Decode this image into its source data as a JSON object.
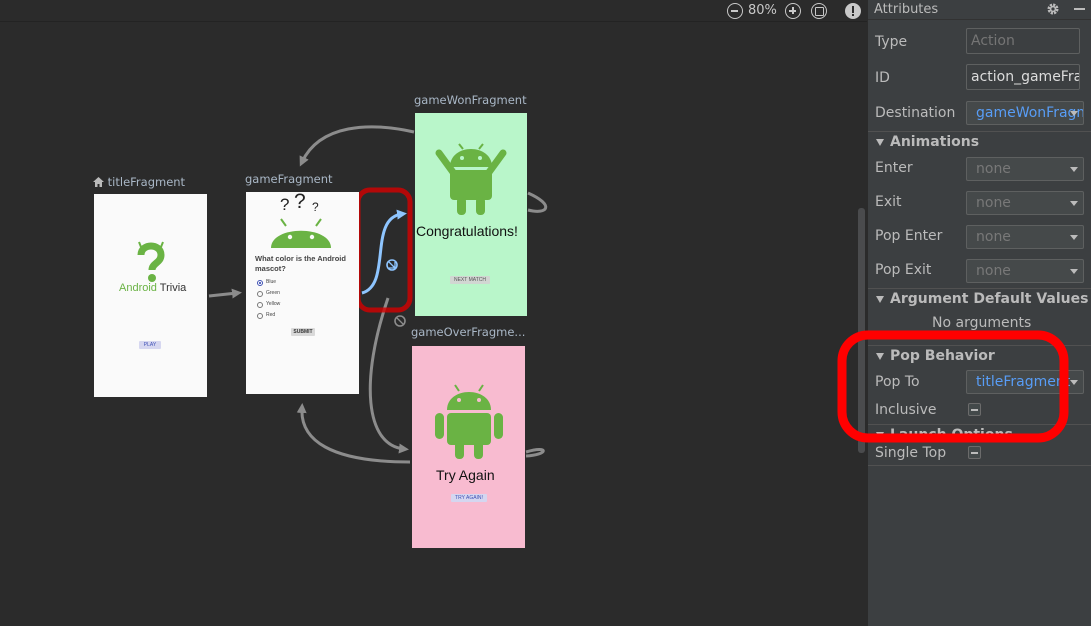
{
  "toolbar": {
    "zoom_level": "80%",
    "icons": [
      "zoom-out-icon",
      "zoom-in-icon",
      "zoom-to-fit-icon",
      "warning-icon"
    ]
  },
  "graph": {
    "destinations": {
      "title": {
        "label": "titleFragment",
        "app_name_green": "Android",
        "app_name_dark": " Trivia",
        "button": "PLAY"
      },
      "game": {
        "label": "gameFragment",
        "question": "What color is the Android mascot?",
        "answers": [
          "Blue",
          "Green",
          "Yellow",
          "Red"
        ],
        "button": "SUBMIT"
      },
      "game_won": {
        "label": "gameWonFragment",
        "message": "Congratulations!",
        "button": "NEXT MATCH"
      },
      "game_over": {
        "label": "gameOverFragme...",
        "message": "Try Again",
        "button": "TRY AGAIN!"
      }
    },
    "colors": {
      "canvas": "#2b2b2b",
      "android_green": "#6ab344",
      "won_bg": "#b9f6ca",
      "over_bg": "#f8bbd0",
      "action_arrow": "#8c8c8c",
      "selected_arrow": "#8ec5ff",
      "highlight": "#e00000"
    }
  },
  "attributes": {
    "title": "Attributes",
    "type": {
      "label": "Type",
      "placeholder": "Action"
    },
    "id": {
      "label": "ID",
      "value": "action_gameFragment_to_gameWonFragment"
    },
    "destination": {
      "label": "Destination",
      "value": "gameWonFragment"
    },
    "animations": {
      "title": "Animations",
      "enter": {
        "label": "Enter",
        "value": "none"
      },
      "exit": {
        "label": "Exit",
        "value": "none"
      },
      "pop_enter": {
        "label": "Pop Enter",
        "value": "none"
      },
      "pop_exit": {
        "label": "Pop Exit",
        "value": "none"
      }
    },
    "argument_defaults": {
      "title": "Argument Default Values",
      "empty": "No arguments"
    },
    "pop_behavior": {
      "title": "Pop Behavior",
      "pop_to": {
        "label": "Pop To",
        "value": "titleFragment"
      },
      "inclusive": {
        "label": "Inclusive",
        "checked": "indeterminate"
      }
    },
    "launch_options": {
      "title": "Launch Options",
      "single_top": {
        "label": "Single Top",
        "checked": "indeterminate"
      }
    },
    "colors": {
      "panel_bg": "#3c3f41",
      "link_value": "#589df6"
    }
  }
}
